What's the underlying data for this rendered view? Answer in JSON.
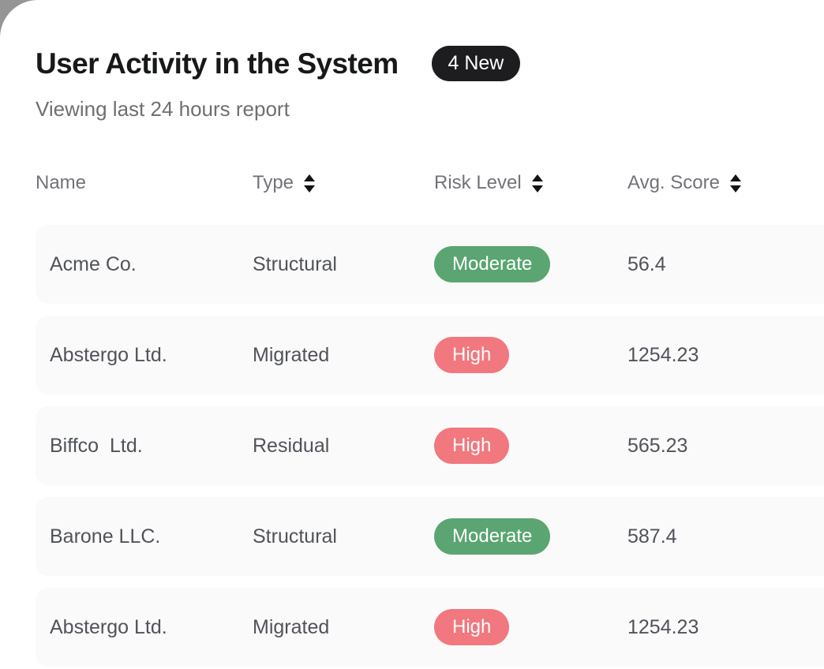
{
  "page": {
    "title": "User Activity in the System",
    "new_badge": "4 New",
    "subtitle": "Viewing last 24 hours report"
  },
  "table": {
    "columns": [
      {
        "label": "Name",
        "sortable": false
      },
      {
        "label": "Type",
        "sortable": true
      },
      {
        "label": "Risk Level",
        "sortable": true
      },
      {
        "label": "Avg. Score",
        "sortable": true
      }
    ],
    "rows": [
      {
        "name": "Acme Co.",
        "type": "Structural",
        "risk": "Moderate",
        "score": "56.4"
      },
      {
        "name": "Abstergo Ltd.",
        "type": "Migrated",
        "risk": "High",
        "score": "1254.23"
      },
      {
        "name": "Biffco  Ltd.",
        "type": "Residual",
        "risk": "High",
        "score": "565.23"
      },
      {
        "name": "Barone LLC.",
        "type": "Structural",
        "risk": "Moderate",
        "score": "587.4"
      },
      {
        "name": "Abstergo Ltd.",
        "type": "Migrated",
        "risk": "High",
        "score": "1254.23"
      }
    ]
  },
  "colors": {
    "risk_moderate": "#5AA571",
    "risk_high": "#F1787E",
    "new_badge_bg": "#1D1D20",
    "row_bg": "#FAFAFB",
    "behind_card": "#959595"
  }
}
